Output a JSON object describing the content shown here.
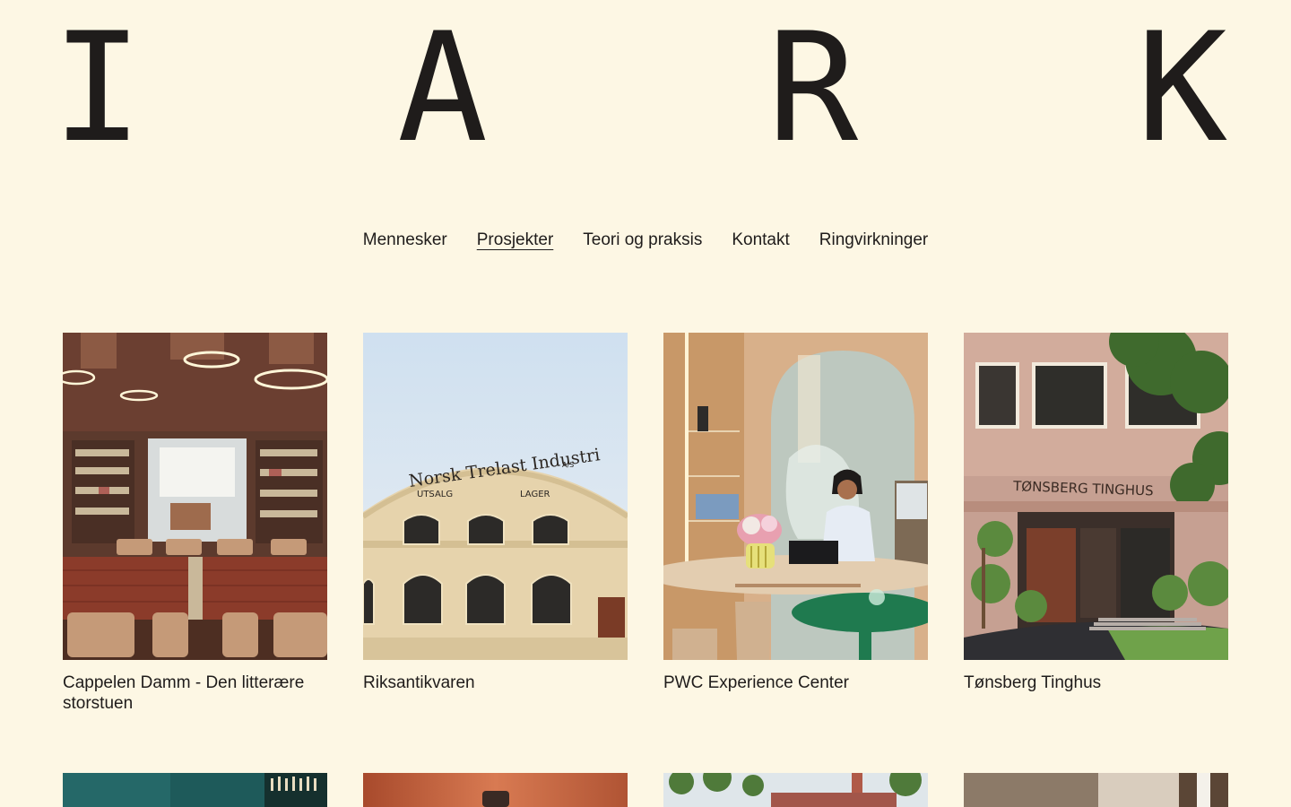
{
  "logo": {
    "letters": [
      "I",
      "A",
      "R",
      "K"
    ]
  },
  "nav": {
    "items": [
      {
        "label": "Mennesker"
      },
      {
        "label": "Prosjekter",
        "active": true
      },
      {
        "label": "Teori og praksis"
      },
      {
        "label": "Kontakt"
      },
      {
        "label": "Ringvirkninger"
      }
    ]
  },
  "projects": [
    {
      "title": "Cappelen Damm - Den litterære storstuen"
    },
    {
      "title": "Riksantikvaren",
      "sign_line1": "Norsk Trelast Industri",
      "sign_superscript": "A/S",
      "sign_left": "UTSALG",
      "sign_right": "LAGER"
    },
    {
      "title": "PWC Experience Center"
    },
    {
      "title": "Tønsberg Tinghus",
      "sign": "TØNSBERG TINGHUS"
    }
  ],
  "colors": {
    "background": "#fdf7e4",
    "text": "#1f1c1b"
  }
}
